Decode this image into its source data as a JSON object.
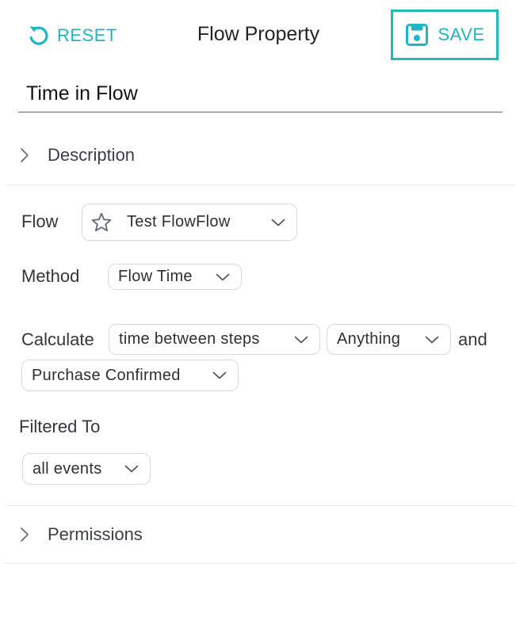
{
  "header": {
    "reset_label": "RESET",
    "title": "Flow Property",
    "save_label": "SAVE"
  },
  "name_field": {
    "value": "Time in Flow"
  },
  "sections": {
    "description": "Description",
    "permissions": "Permissions"
  },
  "form": {
    "flow": {
      "label": "Flow",
      "value": "Test FlowFlow"
    },
    "method": {
      "label": "Method",
      "value": "Flow Time"
    },
    "calculate": {
      "label": "Calculate",
      "mode": "time between steps",
      "from_step": "Anything",
      "conjunction": "and",
      "to_step": "Purchase Confirmed"
    },
    "filtered_to": {
      "label": "Filtered To",
      "value": "all events"
    }
  },
  "icons": {
    "reset": "reset-arrow-icon",
    "save": "floppy-disk-icon",
    "flow": "star-outline-icon",
    "expand": "chevron-right-icon",
    "dropdown": "chevron-down-icon"
  },
  "colors": {
    "accent": "#1fb5c9",
    "save_highlight": "#1fbcb3",
    "border": "#d5d9de",
    "divider": "#e6e8eb"
  }
}
